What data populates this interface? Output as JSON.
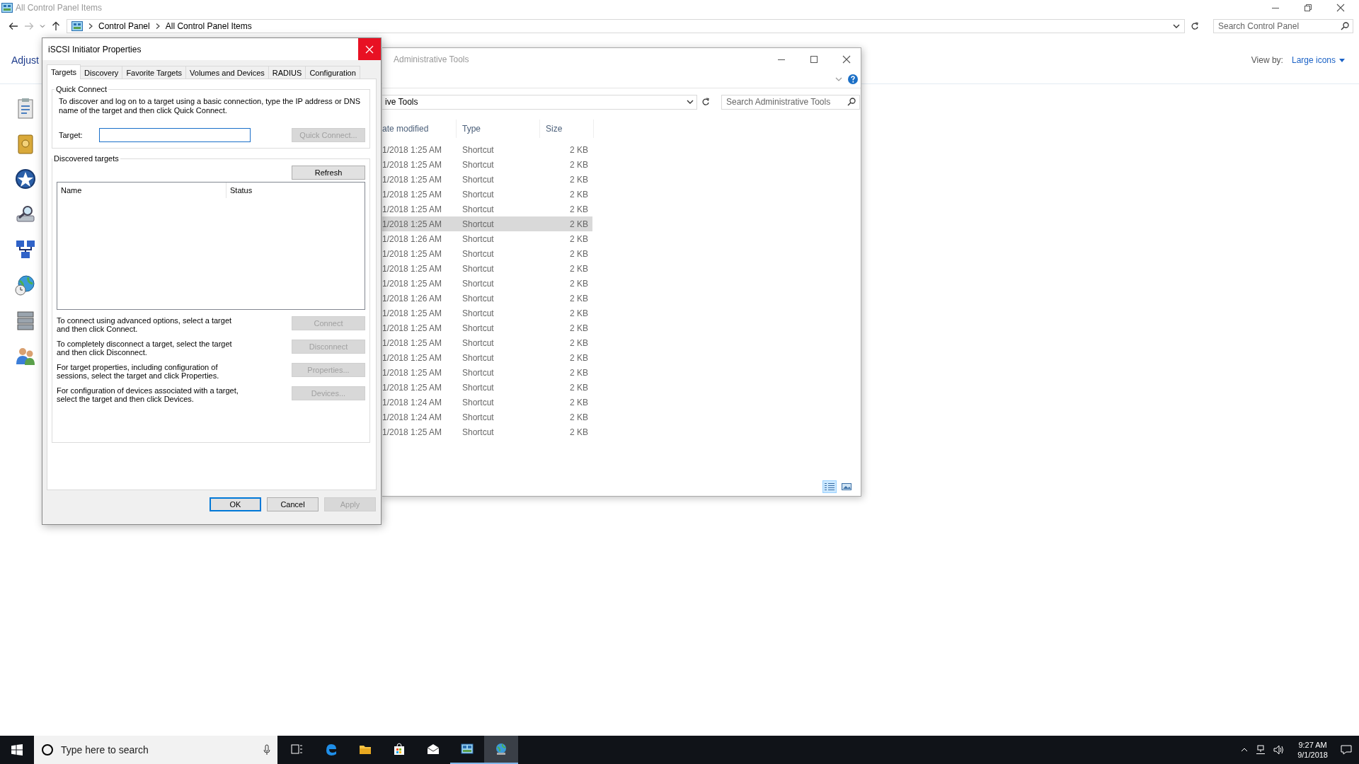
{
  "control_panel": {
    "title": "All Control Panel Items",
    "breadcrumb": [
      "Control Panel",
      "All Control Panel Items"
    ],
    "search": {
      "placeholder": "Search Control Panel"
    },
    "heading": "Adjust",
    "view_by_label": "View by:",
    "view_by_value": "Large icons"
  },
  "admin_tools": {
    "title": "Administrative Tools",
    "address": "ive Tools",
    "search": {
      "placeholder": "Search Administrative Tools"
    },
    "columns": [
      "ate modified",
      "Type",
      "Size"
    ],
    "rows": [
      {
        "date": "1/2018 1:25 AM",
        "type": "Shortcut",
        "size": "2 KB",
        "selected": false
      },
      {
        "date": "1/2018 1:25 AM",
        "type": "Shortcut",
        "size": "2 KB",
        "selected": false
      },
      {
        "date": "1/2018 1:25 AM",
        "type": "Shortcut",
        "size": "2 KB",
        "selected": false
      },
      {
        "date": "1/2018 1:25 AM",
        "type": "Shortcut",
        "size": "2 KB",
        "selected": false
      },
      {
        "date": "1/2018 1:25 AM",
        "type": "Shortcut",
        "size": "2 KB",
        "selected": false
      },
      {
        "date": "1/2018 1:25 AM",
        "type": "Shortcut",
        "size": "2 KB",
        "selected": true
      },
      {
        "date": "1/2018 1:26 AM",
        "type": "Shortcut",
        "size": "2 KB",
        "selected": false
      },
      {
        "date": "1/2018 1:25 AM",
        "type": "Shortcut",
        "size": "2 KB",
        "selected": false
      },
      {
        "date": "1/2018 1:25 AM",
        "type": "Shortcut",
        "size": "2 KB",
        "selected": false
      },
      {
        "date": "1/2018 1:25 AM",
        "type": "Shortcut",
        "size": "2 KB",
        "selected": false
      },
      {
        "date": "1/2018 1:26 AM",
        "type": "Shortcut",
        "size": "2 KB",
        "selected": false
      },
      {
        "date": "1/2018 1:25 AM",
        "type": "Shortcut",
        "size": "2 KB",
        "selected": false
      },
      {
        "date": "1/2018 1:25 AM",
        "type": "Shortcut",
        "size": "2 KB",
        "selected": false
      },
      {
        "date": "1/2018 1:25 AM",
        "type": "Shortcut",
        "size": "2 KB",
        "selected": false
      },
      {
        "date": "1/2018 1:25 AM",
        "type": "Shortcut",
        "size": "2 KB",
        "selected": false
      },
      {
        "date": "1/2018 1:25 AM",
        "type": "Shortcut",
        "size": "2 KB",
        "selected": false
      },
      {
        "date": "1/2018 1:25 AM",
        "type": "Shortcut",
        "size": "2 KB",
        "selected": false
      },
      {
        "date": "1/2018 1:24 AM",
        "type": "Shortcut",
        "size": "2 KB",
        "selected": false
      },
      {
        "date": "1/2018 1:24 AM",
        "type": "Shortcut",
        "size": "2 KB",
        "selected": false
      },
      {
        "date": "1/2018 1:25 AM",
        "type": "Shortcut",
        "size": "2 KB",
        "selected": false
      }
    ],
    "view_modes": [
      {
        "kind": "details",
        "selected": true
      },
      {
        "kind": "large_icons",
        "selected": false
      }
    ]
  },
  "dialog": {
    "title": "iSCSI Initiator Properties",
    "tabs": [
      {
        "label": "Targets",
        "selected": true
      },
      {
        "label": "Discovery",
        "selected": false
      },
      {
        "label": "Favorite Targets",
        "selected": false
      },
      {
        "label": "Volumes and Devices",
        "selected": false
      },
      {
        "label": "RADIUS",
        "selected": false
      },
      {
        "label": "Configuration",
        "selected": false
      }
    ],
    "quick_connect": {
      "legend": "Quick Connect",
      "description": "To discover and log on to a target using a basic connection, type the IP address or DNS name of the target and then click Quick Connect.",
      "target_label": "Target:",
      "button": {
        "label": "Quick Connect...",
        "disabled": true
      }
    },
    "discovered": {
      "legend": "Discovered targets",
      "refresh": {
        "label": "Refresh",
        "disabled": false
      },
      "columns": [
        "Name",
        "Status"
      ]
    },
    "actions": [
      {
        "description": "To connect using advanced options, select a target and then click Connect.",
        "button": {
          "label": "Connect",
          "disabled": true
        }
      },
      {
        "description": "To completely disconnect a target, select the target and then click Disconnect.",
        "button": {
          "label": "Disconnect",
          "disabled": true
        }
      },
      {
        "description": "For target properties, including configuration of sessions, select the target and click Properties.",
        "button": {
          "label": "Properties...",
          "disabled": true
        }
      },
      {
        "description": "For configuration of devices associated with a target, select the target and then click Devices.",
        "button": {
          "label": "Devices...",
          "disabled": true
        }
      }
    ],
    "buttons": [
      {
        "label": "OK",
        "default": true,
        "disabled": false
      },
      {
        "label": "Cancel",
        "default": false,
        "disabled": false
      },
      {
        "label": "Apply",
        "default": false,
        "disabled": true
      }
    ]
  },
  "taskbar": {
    "search": {
      "placeholder": "Type here to search"
    },
    "apps": [
      {
        "kind": "task_view",
        "running": false,
        "selected": false
      },
      {
        "kind": "edge",
        "running": false,
        "selected": false
      },
      {
        "kind": "explorer",
        "running": false,
        "selected": false
      },
      {
        "kind": "store",
        "running": false,
        "selected": false
      },
      {
        "kind": "mail",
        "running": false,
        "selected": false
      },
      {
        "kind": "control_panel",
        "running": true,
        "selected": false
      },
      {
        "kind": "iscsi",
        "running": true,
        "selected": true
      }
    ],
    "clock": {
      "time": "9:27 AM",
      "date": "9/1/2018"
    }
  }
}
